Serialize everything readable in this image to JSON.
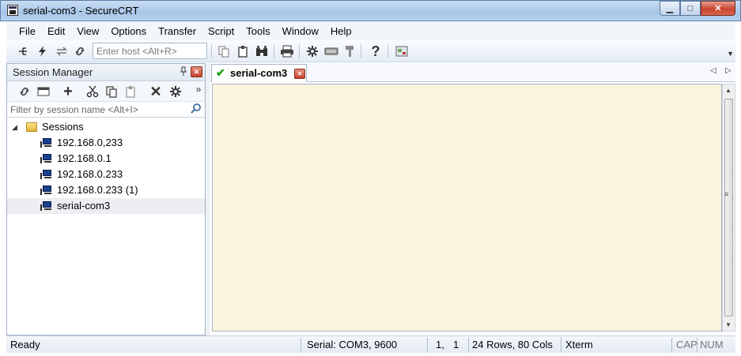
{
  "window": {
    "title": "serial-com3 - SecureCRT",
    "minimize_glyph": "▁",
    "maximize_glyph": "□",
    "close_glyph": "✕"
  },
  "menu": [
    "File",
    "Edit",
    "View",
    "Options",
    "Transfer",
    "Script",
    "Tools",
    "Window",
    "Help"
  ],
  "toolbar": {
    "host_placeholder": "Enter host <Alt+R>",
    "icons": [
      "connect-icon",
      "quick-connect-icon",
      "reconnect-icon",
      "disconnect-icon",
      "copy-icon",
      "paste-icon",
      "find-icon",
      "print-icon",
      "session-options-icon",
      "keymap-icon",
      "key-icon",
      "help-icon",
      "screen-icon"
    ],
    "overflow": "▼"
  },
  "session_manager": {
    "title": "Session Manager",
    "pin": "📌",
    "close": "✕",
    "overflow": "»",
    "filter_placeholder": "Filter by session name <Alt+I>",
    "root": {
      "label": "Sessions",
      "expanded": true
    },
    "sessions": [
      {
        "label": "192.168.0,233",
        "selected": false
      },
      {
        "label": "192.168.0.1",
        "selected": false
      },
      {
        "label": "192.168.0.233",
        "selected": false
      },
      {
        "label": "192.168.0.233 (1)",
        "selected": false
      },
      {
        "label": "serial-com3",
        "selected": true
      }
    ]
  },
  "tabs": [
    {
      "label": "serial-com3",
      "status": "connected",
      "close": "✕"
    }
  ],
  "tab_scroll": {
    "left": "◁",
    "right": "▷"
  },
  "terminal": {
    "background": "#fcf3df"
  },
  "statusbar": {
    "ready": "Ready",
    "connection": "Serial: COM3, 9600",
    "row": "1,",
    "col": "1",
    "size": "24 Rows, 80 Cols",
    "emulation": "Xterm",
    "cap": "CAP",
    "num": "NUM"
  }
}
